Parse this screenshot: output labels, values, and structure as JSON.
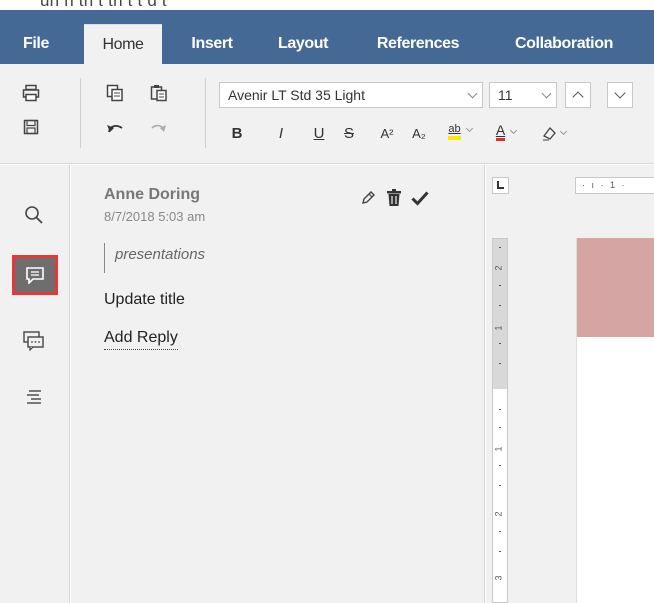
{
  "top_strip": {
    "text": "un  h   th      t th    t   t   d   t"
  },
  "menu": {
    "tabs": [
      {
        "label": "File"
      },
      {
        "label": "Home"
      },
      {
        "label": "Insert"
      },
      {
        "label": "Layout"
      },
      {
        "label": "References"
      },
      {
        "label": "Collaboration"
      }
    ],
    "active_tab": "Home"
  },
  "toolbar": {
    "font_family": "Avenir LT Std 35 Light",
    "font_size": "11",
    "format_buttons": {
      "bold": "B",
      "italic": "I",
      "underline": "U",
      "strikethrough": "S",
      "superscript": "A²",
      "subscript": "A₂",
      "highlight": "ab",
      "font_color": "A"
    },
    "icons": [
      "print-icon",
      "save-icon",
      "copy-icon",
      "paste-icon",
      "undo-icon",
      "redo-icon",
      "highlight-icon",
      "font-color-icon",
      "eraser-icon"
    ]
  },
  "sidebar": {
    "items": [
      {
        "icon": "search-icon"
      },
      {
        "icon": "comment-icon",
        "selected": true
      },
      {
        "icon": "chat-icon"
      },
      {
        "icon": "navigation-icon"
      }
    ]
  },
  "comment": {
    "author": "Anne Doring",
    "date": "8/7/2018 5:03 am",
    "quote": "presentations",
    "text": "Update title",
    "add_reply": "Add Reply"
  },
  "ruler": {
    "horizontal_text": "· ı · 1 ·",
    "vertical_marks": [
      "2",
      "1",
      "1",
      "2",
      "3"
    ]
  },
  "colors": {
    "menu_bar": "#446995",
    "toolbar_bg": "#f1f1f1",
    "selected_outline": "#e5383b",
    "selected_bg": "#6e6e6e",
    "highlight_yellow": "#ffe800",
    "font_color_red": "#e52b2b",
    "page_highlight": "#d4a5a3"
  }
}
